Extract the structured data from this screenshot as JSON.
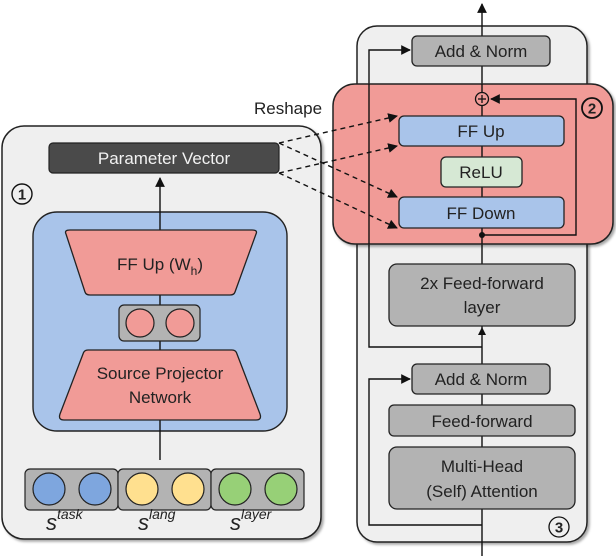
{
  "colors": {
    "panel_bg": "#efefef",
    "projector_bg": "#a9c4ea",
    "adapter_bg": "#f19b97",
    "pink_block": "#f19b97",
    "blue_block": "#a9c4ea",
    "relu_block": "#d6e8d4",
    "gray_block": "#b3b3b3",
    "dark_block": "#4a4a4a",
    "dot_blue": "#7ea6de",
    "dot_yellow": "#ffe08f",
    "dot_green": "#97d077"
  },
  "hypernetwork": {
    "badge": "1",
    "parameter_vector": "Parameter Vector",
    "ff_up": "FF Up (W",
    "ff_up_sub": "h",
    "ff_up_close": ")",
    "source_projector_line1": "Source Projector",
    "source_projector_line2": "Network",
    "embeddings": [
      {
        "base": "s",
        "sup": "task"
      },
      {
        "base": "s",
        "sup": "lang"
      },
      {
        "base": "s",
        "sup": "layer"
      }
    ]
  },
  "reshape_label": "Reshape",
  "adapter": {
    "badge": "2",
    "ff_up": "FF Up",
    "relu": "ReLU",
    "ff_down": "FF Down",
    "sum_symbol": "+"
  },
  "transformer": {
    "badge": "3",
    "add_norm_top": "Add & Norm",
    "ffn_line1": "2x Feed-forward",
    "ffn_line2": "layer",
    "add_norm_bottom": "Add & Norm",
    "feed_forward": "Feed-forward",
    "mha_line1": "Multi-Head",
    "mha_line2": "(Self) Attention"
  }
}
